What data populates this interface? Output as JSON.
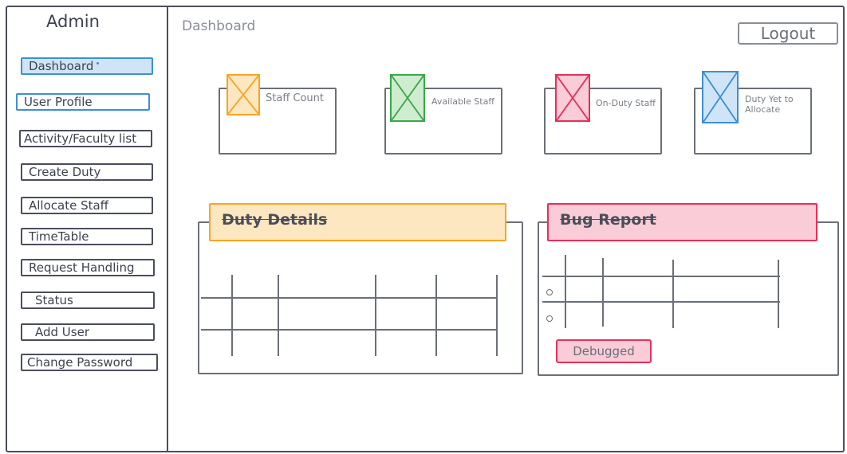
{
  "sidebar": {
    "title": "Admin",
    "items": [
      {
        "label": "Dashboard"
      },
      {
        "label": "User Profile"
      },
      {
        "label": "Activity/Faculty list"
      },
      {
        "label": "Create Duty"
      },
      {
        "label": "Allocate Staff"
      },
      {
        "label": "TimeTable"
      },
      {
        "label": "Request Handling"
      },
      {
        "label": "Status"
      },
      {
        "label": "Add User"
      },
      {
        "label": "Change Password"
      }
    ]
  },
  "header": {
    "title": "Dashboard",
    "logout_label": "Logout"
  },
  "cards": [
    {
      "label": "Staff Count",
      "color": "#f5a623"
    },
    {
      "label": "Available Staff",
      "color": "#3aa84a"
    },
    {
      "label": "On-Duty Staff",
      "color": "#e6305a"
    },
    {
      "label": "Duty Yet to Allocate",
      "color": "#3d8fd6"
    }
  ],
  "panels": {
    "duty_details": {
      "title": "Duty Details",
      "color": "#f5a623"
    },
    "bug_report": {
      "title": "Bug Report",
      "color": "#e6305a",
      "debugged_label": "Debugged"
    }
  }
}
